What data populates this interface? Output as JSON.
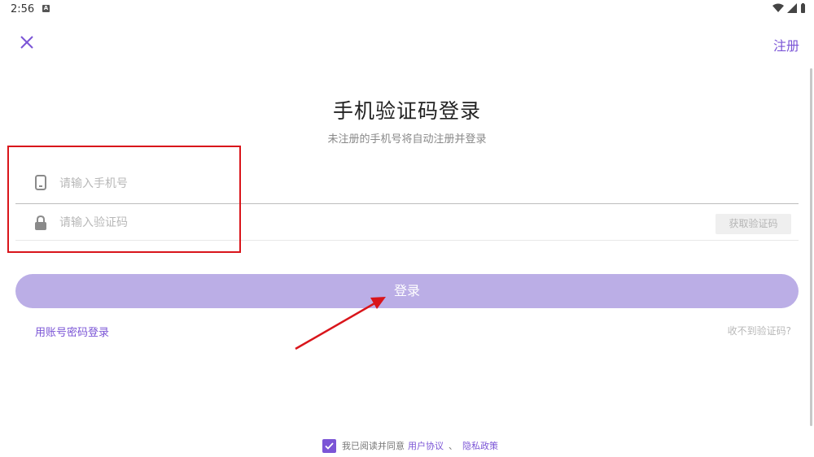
{
  "status_bar": {
    "time": "2:56",
    "app_icon_letter": "A"
  },
  "header": {
    "register_label": "注册"
  },
  "main": {
    "title": "手机验证码登录",
    "subtitle": "未注册的手机号将自动注册并登录",
    "phone": {
      "placeholder": "请输入手机号",
      "value": "",
      "icon": "phone-icon"
    },
    "code": {
      "placeholder": "请输入验证码",
      "value": "",
      "icon": "lock-icon",
      "get_code_label": "获取验证码"
    },
    "login_label": "登录",
    "account_login_link": "用账号密码登录",
    "no_code_link": "收不到验证码?"
  },
  "agreement": {
    "checked": true,
    "text": "我已阅读并同意",
    "user_agreement": "用户协议",
    "separator": "、",
    "privacy_policy": "隐私政策"
  },
  "colors": {
    "accent": "#7b55d6",
    "login_button": "#bbaee6",
    "annotation_red": "#d9151b"
  }
}
